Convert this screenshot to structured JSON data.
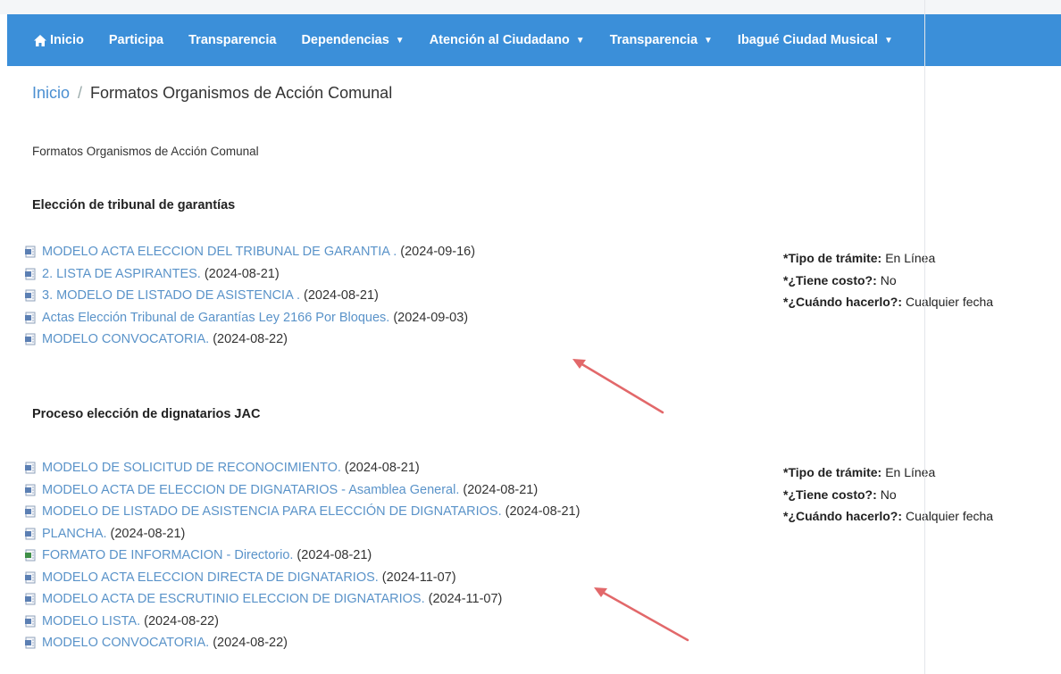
{
  "nav": {
    "items": [
      {
        "label": "Inicio",
        "icon": "home-icon",
        "dropdown": false
      },
      {
        "label": "Participa",
        "dropdown": false
      },
      {
        "label": "Transparencia",
        "dropdown": false
      },
      {
        "label": "Dependencias",
        "dropdown": true
      },
      {
        "label": "Atención al Ciudadano",
        "dropdown": true
      },
      {
        "label": "Transparencia",
        "dropdown": true
      },
      {
        "label": "Ibagué Ciudad Musical",
        "dropdown": true
      }
    ]
  },
  "breadcrumb": {
    "home": "Inicio",
    "separator": "/",
    "current": "Formatos Organismos de Acción Comunal"
  },
  "intro": "Formatos Organismos de Acción Comunal",
  "sections": [
    {
      "title": "Elección de tribunal de garantías",
      "documents": [
        {
          "title": "MODELO ACTA ELECCION DEL TRIBUNAL DE GARANTIA .",
          "date": "(2024-09-16)",
          "icon": "pdf-icon"
        },
        {
          "title": "2. LISTA DE ASPIRANTES.",
          "date": "(2024-08-21)",
          "icon": "pdf-icon"
        },
        {
          "title": "3. MODELO DE LISTADO DE ASISTENCIA .",
          "date": "(2024-08-21)",
          "icon": "pdf-icon"
        },
        {
          "title": "Actas Elección Tribunal de Garantías Ley 2166 Por Bloques.",
          "date": "(2024-09-03)",
          "icon": "pdf-icon"
        },
        {
          "title": "MODELO CONVOCATORIA.",
          "date": "(2024-08-22)",
          "icon": "pdf-icon"
        }
      ],
      "info": [
        {
          "label": "*Tipo de trámite:",
          "value": "En Línea"
        },
        {
          "label": "*¿Tiene costo?:",
          "value": "No"
        },
        {
          "label": "*¿Cuándo hacerlo?:",
          "value": "Cualquier fecha"
        }
      ]
    },
    {
      "title": "Proceso elección de dignatarios JAC",
      "documents": [
        {
          "title": "MODELO DE SOLICITUD DE RECONOCIMIENTO.",
          "date": "(2024-08-21)",
          "icon": "pdf-icon"
        },
        {
          "title": "MODELO ACTA DE ELECCION DE DIGNATARIOS - Asamblea General.",
          "date": "(2024-08-21)",
          "icon": "pdf-icon"
        },
        {
          "title": "MODELO DE LISTADO DE ASISTENCIA PARA ELECCIÓN DE DIGNATARIOS.",
          "date": "(2024-08-21)",
          "icon": "pdf-icon"
        },
        {
          "title": "PLANCHA.",
          "date": "(2024-08-21)",
          "icon": "pdf-icon"
        },
        {
          "title": "FORMATO DE INFORMACION - Directorio.",
          "date": "(2024-08-21)",
          "icon": "excel-icon"
        },
        {
          "title": "MODELO ACTA ELECCION DIRECTA DE DIGNATARIOS.",
          "date": "(2024-11-07)",
          "icon": "pdf-icon"
        },
        {
          "title": "MODELO ACTA DE ESCRUTINIO ELECCION DE DIGNATARIOS.",
          "date": "(2024-11-07)",
          "icon": "pdf-icon"
        },
        {
          "title": "MODELO LISTA.",
          "date": "(2024-08-22)",
          "icon": "pdf-icon"
        },
        {
          "title": "MODELO CONVOCATORIA.",
          "date": "(2024-08-22)",
          "icon": "pdf-icon"
        }
      ],
      "info": [
        {
          "label": "*Tipo de trámite:",
          "value": "En Línea"
        },
        {
          "label": "*¿Tiene costo?:",
          "value": "No"
        },
        {
          "label": "*¿Cuándo hacerlo?:",
          "value": "Cualquier fecha"
        }
      ]
    }
  ],
  "colors": {
    "nav_bg": "#3b8fd9",
    "link": "#5a93c9",
    "arrow": "#e2686a"
  }
}
